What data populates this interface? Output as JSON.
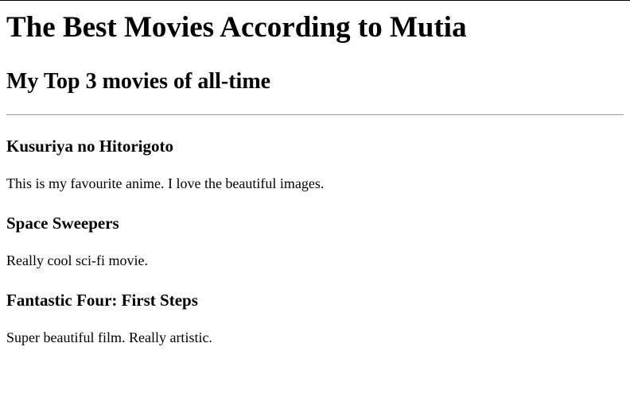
{
  "page": {
    "title": "The Best Movies According to Mutia",
    "subtitle": "My Top 3 movies of all-time"
  },
  "movies": [
    {
      "title": "Kusuriya no Hitorigoto",
      "description": "This is my favourite anime. I love the beautiful images."
    },
    {
      "title": "Space Sweepers",
      "description": "Really cool sci-fi movie."
    },
    {
      "title": "Fantastic Four: First Steps",
      "description": "Super beautiful film. Really artistic."
    }
  ]
}
